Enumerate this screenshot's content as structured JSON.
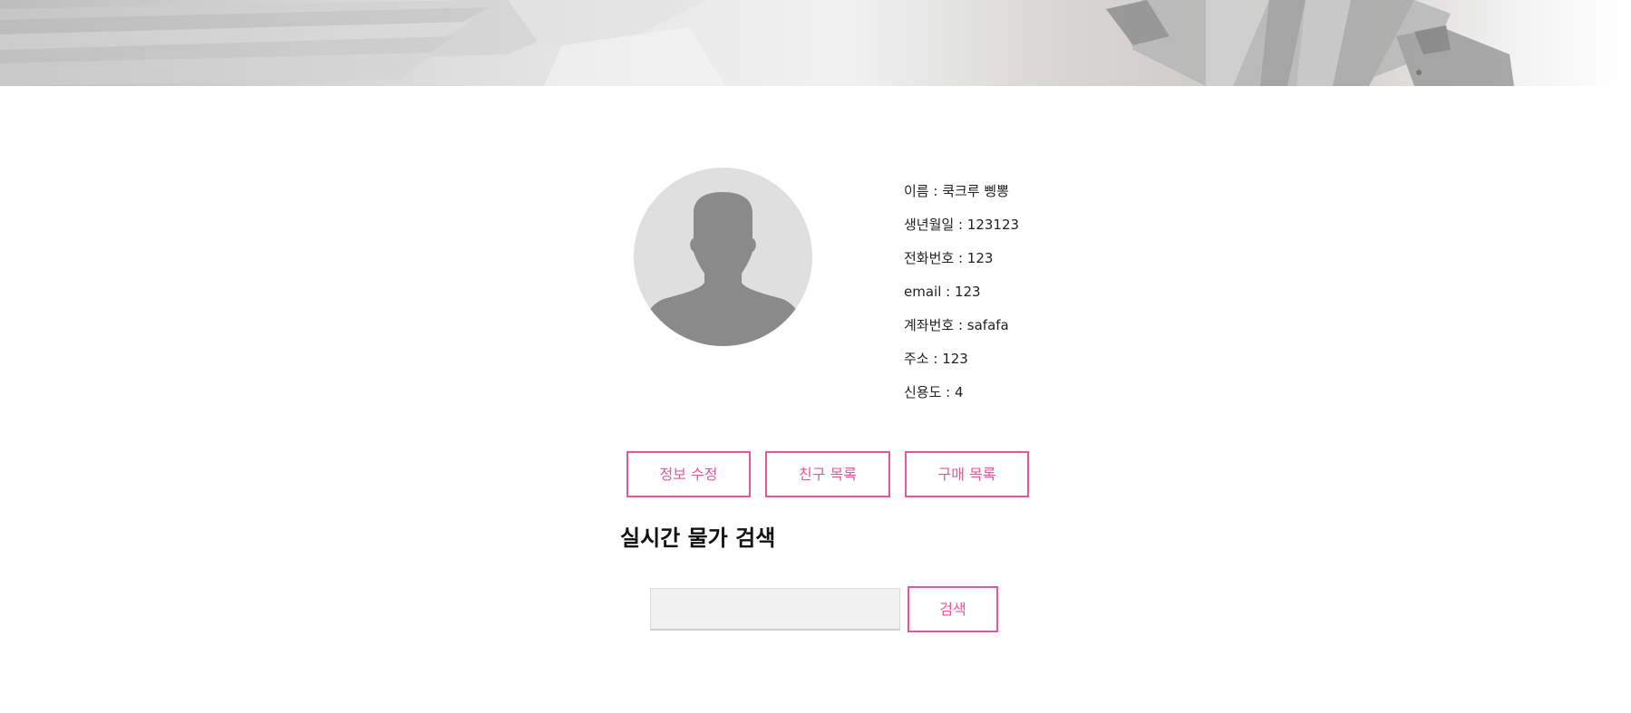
{
  "profile": {
    "name_line": "이름 : 쿡크루 삥뽕",
    "birth_line": "생년월일 : 123123",
    "phone_line": "전화번호 : 123",
    "email_line": "email : 123",
    "account_line": "계좌번호 : safafa",
    "address_line": "주소 : 123",
    "credit_line": "신용도 : 4"
  },
  "actions": {
    "edit_label": "정보 수정",
    "friends_label": "친구 목록",
    "purchases_label": "구매 목록"
  },
  "price_search": {
    "title": "실시간 물가 검색",
    "input_value": "",
    "button_label": "검색"
  },
  "colors": {
    "accent": "#e8559a",
    "avatar_bg": "#dfdfdf",
    "avatar_figure": "#8a8a8a"
  }
}
